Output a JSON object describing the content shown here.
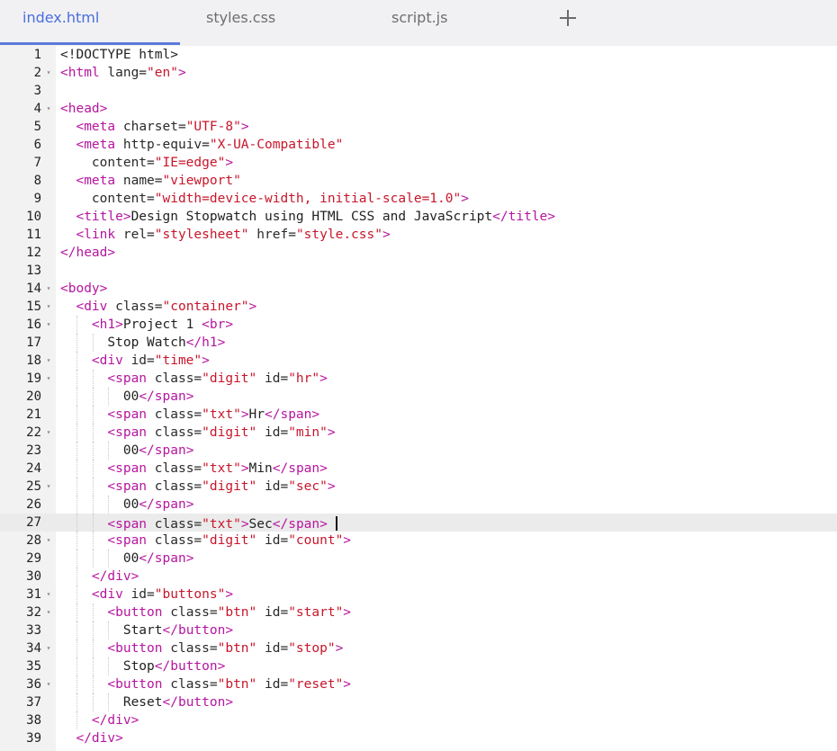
{
  "tabs": [
    {
      "label": "index.html",
      "active": true
    },
    {
      "label": "styles.css",
      "active": false
    },
    {
      "label": "script.js",
      "active": false
    }
  ],
  "add_tab_icon": "plus-icon",
  "colors": {
    "tag": "#b5169f",
    "string": "#c7162b",
    "active_tab": "#4a6edc"
  },
  "editor": {
    "current_line": 27,
    "lines": [
      {
        "n": "1",
        "fold": false,
        "indent": 0,
        "tokens": [
          [
            "x",
            "<!DOCTYPE html>"
          ]
        ]
      },
      {
        "n": "2",
        "fold": true,
        "indent": 0,
        "tokens": [
          [
            "t",
            "<html"
          ],
          [
            "a",
            " lang="
          ],
          [
            "s",
            "\"en\""
          ],
          [
            "t",
            ">"
          ]
        ]
      },
      {
        "n": "3",
        "fold": false,
        "indent": 0,
        "tokens": []
      },
      {
        "n": "4",
        "fold": true,
        "indent": 0,
        "tokens": [
          [
            "t",
            "<head>"
          ]
        ]
      },
      {
        "n": "5",
        "fold": false,
        "indent": 1,
        "tokens": [
          [
            "x",
            "  "
          ],
          [
            "t",
            "<meta"
          ],
          [
            "a",
            " charset="
          ],
          [
            "s",
            "\"UTF-8\""
          ],
          [
            "t",
            ">"
          ]
        ]
      },
      {
        "n": "6",
        "fold": false,
        "indent": 1,
        "tokens": [
          [
            "x",
            "  "
          ],
          [
            "t",
            "<meta"
          ],
          [
            "a",
            " http-equiv="
          ],
          [
            "s",
            "\"X-UA-Compatible\""
          ]
        ]
      },
      {
        "n": "7",
        "fold": false,
        "indent": 1,
        "tokens": [
          [
            "x",
            "    "
          ],
          [
            "a",
            "content="
          ],
          [
            "s",
            "\"IE=edge\""
          ],
          [
            "t",
            ">"
          ]
        ]
      },
      {
        "n": "8",
        "fold": false,
        "indent": 1,
        "tokens": [
          [
            "x",
            "  "
          ],
          [
            "t",
            "<meta"
          ],
          [
            "a",
            " name="
          ],
          [
            "s",
            "\"viewport\""
          ]
        ]
      },
      {
        "n": "9",
        "fold": false,
        "indent": 1,
        "tokens": [
          [
            "x",
            "    "
          ],
          [
            "a",
            "content="
          ],
          [
            "s",
            "\"width=device-width, initial-scale=1.0\""
          ],
          [
            "t",
            ">"
          ]
        ]
      },
      {
        "n": "10",
        "fold": false,
        "indent": 1,
        "tokens": [
          [
            "x",
            "  "
          ],
          [
            "t",
            "<title>"
          ],
          [
            "x",
            "Design Stopwatch using HTML CSS and JavaScript"
          ],
          [
            "t",
            "</title>"
          ]
        ]
      },
      {
        "n": "11",
        "fold": false,
        "indent": 1,
        "tokens": [
          [
            "x",
            "  "
          ],
          [
            "t",
            "<link"
          ],
          [
            "a",
            " rel="
          ],
          [
            "s",
            "\"stylesheet\""
          ],
          [
            "a",
            " href="
          ],
          [
            "s",
            "\"style.css\""
          ],
          [
            "t",
            ">"
          ]
        ]
      },
      {
        "n": "12",
        "fold": false,
        "indent": 0,
        "tokens": [
          [
            "t",
            "</head>"
          ]
        ]
      },
      {
        "n": "13",
        "fold": false,
        "indent": 0,
        "tokens": []
      },
      {
        "n": "14",
        "fold": true,
        "indent": 0,
        "tokens": [
          [
            "t",
            "<body>"
          ]
        ]
      },
      {
        "n": "15",
        "fold": true,
        "indent": 1,
        "tokens": [
          [
            "x",
            "  "
          ],
          [
            "t",
            "<div"
          ],
          [
            "a",
            " class="
          ],
          [
            "s",
            "\"container\""
          ],
          [
            "t",
            ">"
          ]
        ]
      },
      {
        "n": "16",
        "fold": true,
        "indent": 2,
        "tokens": [
          [
            "x",
            "    "
          ],
          [
            "t",
            "<h1>"
          ],
          [
            "x",
            "Project 1 "
          ],
          [
            "t",
            "<br>"
          ]
        ]
      },
      {
        "n": "17",
        "fold": false,
        "indent": 3,
        "tokens": [
          [
            "x",
            "      Stop Watch"
          ],
          [
            "t",
            "</h1>"
          ]
        ]
      },
      {
        "n": "18",
        "fold": true,
        "indent": 2,
        "tokens": [
          [
            "x",
            "    "
          ],
          [
            "t",
            "<div"
          ],
          [
            "a",
            " id="
          ],
          [
            "s",
            "\"time\""
          ],
          [
            "t",
            ">"
          ]
        ]
      },
      {
        "n": "19",
        "fold": true,
        "indent": 3,
        "tokens": [
          [
            "x",
            "      "
          ],
          [
            "t",
            "<span"
          ],
          [
            "a",
            " class="
          ],
          [
            "s",
            "\"digit\""
          ],
          [
            "a",
            " id="
          ],
          [
            "s",
            "\"hr\""
          ],
          [
            "t",
            ">"
          ]
        ]
      },
      {
        "n": "20",
        "fold": false,
        "indent": 4,
        "tokens": [
          [
            "x",
            "        00"
          ],
          [
            "t",
            "</span>"
          ]
        ]
      },
      {
        "n": "21",
        "fold": false,
        "indent": 3,
        "tokens": [
          [
            "x",
            "      "
          ],
          [
            "t",
            "<span"
          ],
          [
            "a",
            " class="
          ],
          [
            "s",
            "\"txt\""
          ],
          [
            "t",
            ">"
          ],
          [
            "x",
            "Hr"
          ],
          [
            "t",
            "</span>"
          ]
        ]
      },
      {
        "n": "22",
        "fold": true,
        "indent": 3,
        "tokens": [
          [
            "x",
            "      "
          ],
          [
            "t",
            "<span"
          ],
          [
            "a",
            " class="
          ],
          [
            "s",
            "\"digit\""
          ],
          [
            "a",
            " id="
          ],
          [
            "s",
            "\"min\""
          ],
          [
            "t",
            ">"
          ]
        ]
      },
      {
        "n": "23",
        "fold": false,
        "indent": 4,
        "tokens": [
          [
            "x",
            "        00"
          ],
          [
            "t",
            "</span>"
          ]
        ]
      },
      {
        "n": "24",
        "fold": false,
        "indent": 3,
        "tokens": [
          [
            "x",
            "      "
          ],
          [
            "t",
            "<span"
          ],
          [
            "a",
            " class="
          ],
          [
            "s",
            "\"txt\""
          ],
          [
            "t",
            ">"
          ],
          [
            "x",
            "Min"
          ],
          [
            "t",
            "</span>"
          ]
        ]
      },
      {
        "n": "25",
        "fold": true,
        "indent": 3,
        "tokens": [
          [
            "x",
            "      "
          ],
          [
            "t",
            "<span"
          ],
          [
            "a",
            " class="
          ],
          [
            "s",
            "\"digit\""
          ],
          [
            "a",
            " id="
          ],
          [
            "s",
            "\"sec\""
          ],
          [
            "t",
            ">"
          ]
        ]
      },
      {
        "n": "26",
        "fold": false,
        "indent": 4,
        "tokens": [
          [
            "x",
            "        00"
          ],
          [
            "t",
            "</span>"
          ]
        ]
      },
      {
        "n": "27",
        "fold": false,
        "indent": 3,
        "tokens": [
          [
            "x",
            "      "
          ],
          [
            "t",
            "<span"
          ],
          [
            "a",
            " class="
          ],
          [
            "s",
            "\"txt\""
          ],
          [
            "t",
            ">"
          ],
          [
            "x",
            "Sec"
          ],
          [
            "t",
            "</span>"
          ],
          [
            "x",
            " "
          ]
        ]
      },
      {
        "n": "28",
        "fold": true,
        "indent": 3,
        "tokens": [
          [
            "x",
            "      "
          ],
          [
            "t",
            "<span"
          ],
          [
            "a",
            " class="
          ],
          [
            "s",
            "\"digit\""
          ],
          [
            "a",
            " id="
          ],
          [
            "s",
            "\"count\""
          ],
          [
            "t",
            ">"
          ]
        ]
      },
      {
        "n": "29",
        "fold": false,
        "indent": 4,
        "tokens": [
          [
            "x",
            "        00"
          ],
          [
            "t",
            "</span>"
          ]
        ]
      },
      {
        "n": "30",
        "fold": false,
        "indent": 2,
        "tokens": [
          [
            "x",
            "    "
          ],
          [
            "t",
            "</div>"
          ]
        ]
      },
      {
        "n": "31",
        "fold": true,
        "indent": 2,
        "tokens": [
          [
            "x",
            "    "
          ],
          [
            "t",
            "<div"
          ],
          [
            "a",
            " id="
          ],
          [
            "s",
            "\"buttons\""
          ],
          [
            "t",
            ">"
          ]
        ]
      },
      {
        "n": "32",
        "fold": true,
        "indent": 3,
        "tokens": [
          [
            "x",
            "      "
          ],
          [
            "t",
            "<button"
          ],
          [
            "a",
            " class="
          ],
          [
            "s",
            "\"btn\""
          ],
          [
            "a",
            " id="
          ],
          [
            "s",
            "\"start\""
          ],
          [
            "t",
            ">"
          ]
        ]
      },
      {
        "n": "33",
        "fold": false,
        "indent": 4,
        "tokens": [
          [
            "x",
            "        Start"
          ],
          [
            "t",
            "</button>"
          ]
        ]
      },
      {
        "n": "34",
        "fold": true,
        "indent": 3,
        "tokens": [
          [
            "x",
            "      "
          ],
          [
            "t",
            "<button"
          ],
          [
            "a",
            " class="
          ],
          [
            "s",
            "\"btn\""
          ],
          [
            "a",
            " id="
          ],
          [
            "s",
            "\"stop\""
          ],
          [
            "t",
            ">"
          ]
        ]
      },
      {
        "n": "35",
        "fold": false,
        "indent": 4,
        "tokens": [
          [
            "x",
            "        Stop"
          ],
          [
            "t",
            "</button>"
          ]
        ]
      },
      {
        "n": "36",
        "fold": true,
        "indent": 3,
        "tokens": [
          [
            "x",
            "      "
          ],
          [
            "t",
            "<button"
          ],
          [
            "a",
            " class="
          ],
          [
            "s",
            "\"btn\""
          ],
          [
            "a",
            " id="
          ],
          [
            "s",
            "\"reset\""
          ],
          [
            "t",
            ">"
          ]
        ]
      },
      {
        "n": "37",
        "fold": false,
        "indent": 4,
        "tokens": [
          [
            "x",
            "        Reset"
          ],
          [
            "t",
            "</button>"
          ]
        ]
      },
      {
        "n": "38",
        "fold": false,
        "indent": 2,
        "tokens": [
          [
            "x",
            "    "
          ],
          [
            "t",
            "</div>"
          ]
        ]
      },
      {
        "n": "39",
        "fold": false,
        "indent": 1,
        "tokens": [
          [
            "x",
            "  "
          ],
          [
            "t",
            "</div>"
          ]
        ]
      }
    ]
  }
}
